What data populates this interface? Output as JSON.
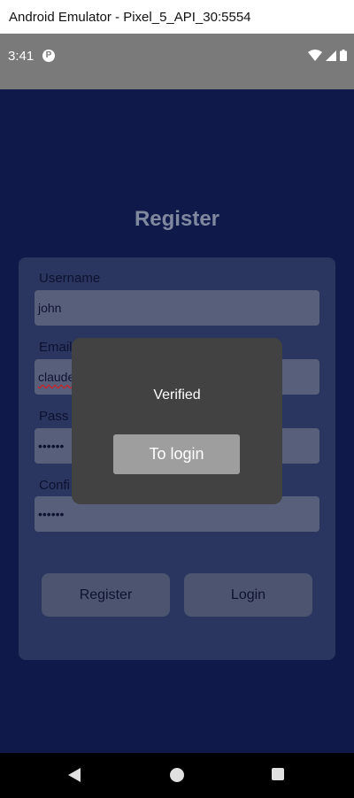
{
  "window": {
    "title": "Android Emulator - Pixel_5_API_30:5554"
  },
  "status_bar": {
    "time": "3:41",
    "icons": [
      "parking-app-icon",
      "wifi-icon",
      "signal-icon",
      "battery-icon"
    ]
  },
  "page": {
    "title": "Register"
  },
  "form": {
    "username_label": "Username",
    "username_value": "john",
    "email_label": "Email",
    "email_value": "claude",
    "password_label": "Pass",
    "password_value": "••••••",
    "confirm_label": "Confi",
    "confirm_value": "••••••"
  },
  "buttons": {
    "register": "Register",
    "login": "Login"
  },
  "dialog": {
    "message": "Verified",
    "button": "To login"
  },
  "nav_bar": {
    "icons": [
      "back-icon",
      "home-icon",
      "recents-icon"
    ]
  },
  "colors": {
    "background": "#0f1a4a",
    "card": "#2a365f",
    "dialog": "#424242",
    "dialog_button": "#9e9e9e"
  }
}
